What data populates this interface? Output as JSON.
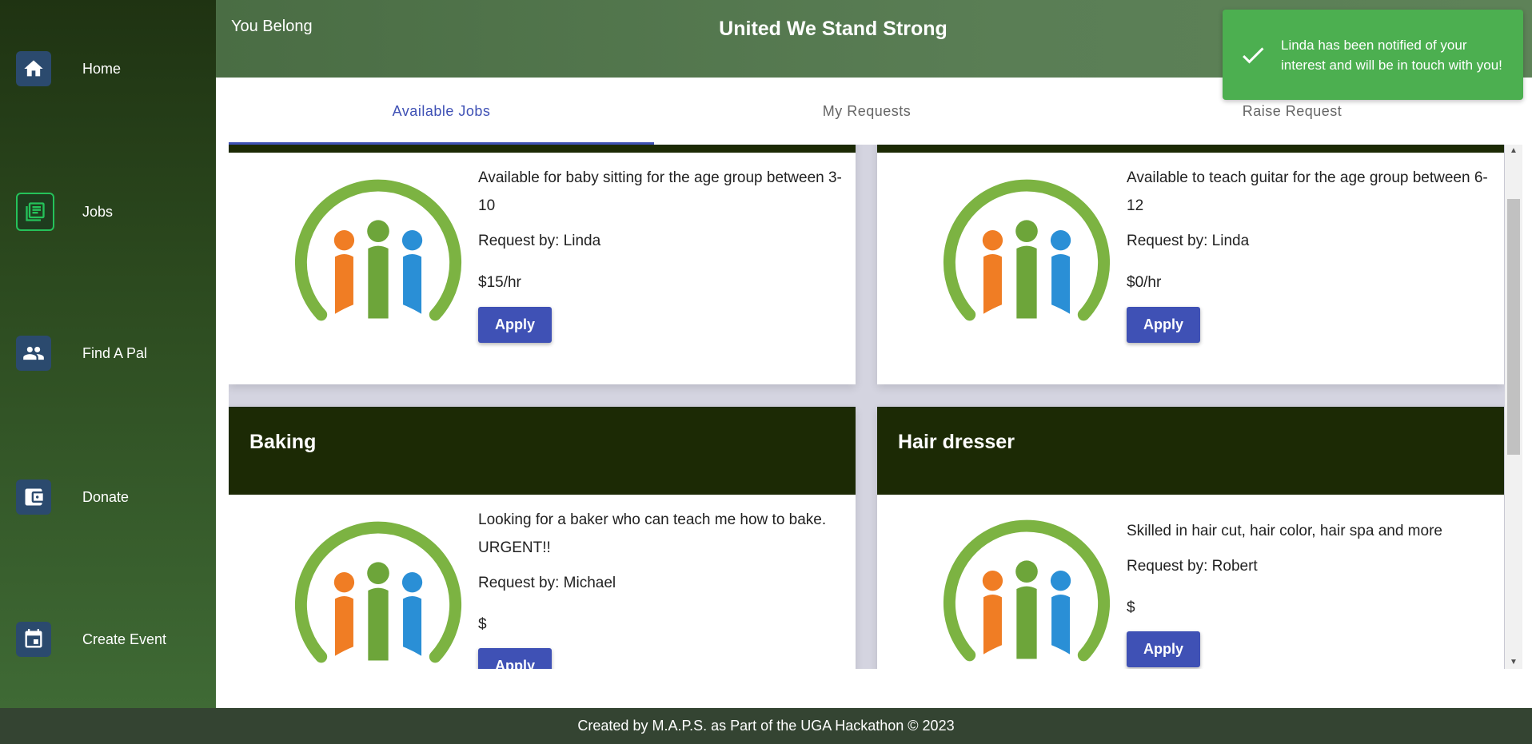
{
  "sidebar": {
    "items": [
      {
        "label": "Home",
        "icon": "home-icon"
      },
      {
        "label": "Jobs",
        "icon": "newspaper-icon",
        "active": true
      },
      {
        "label": "Find A Pal",
        "icon": "people-icon"
      },
      {
        "label": "Donate",
        "icon": "wallet-icon"
      },
      {
        "label": "Create Event",
        "icon": "calendar-icon"
      }
    ]
  },
  "header": {
    "brand": "You Belong",
    "title": "United We Stand Strong"
  },
  "toast": {
    "message": "Linda has been notified of your interest and will be in touch with you!",
    "icon": "check-icon",
    "color": "#4caf50"
  },
  "tabs": [
    {
      "label": "Available Jobs",
      "active": true
    },
    {
      "label": "My Requests"
    },
    {
      "label": "Raise Request"
    }
  ],
  "cards": [
    {
      "description": "Available for baby sitting for the age group between 3-10",
      "requester": "Request by: Linda",
      "rate": "$15/hr",
      "button": "Apply"
    },
    {
      "description": "Available to teach guitar for the age group between 6-12",
      "requester": "Request by: Linda",
      "rate": "$0/hr",
      "button": "Apply"
    },
    {
      "title": "Baking",
      "description": "Looking for a baker who can teach me how to bake. URGENT!!",
      "requester": "Request by: Michael",
      "rate": "$",
      "button": "Apply"
    },
    {
      "title": "Hair dresser",
      "description": "Skilled in hair cut, hair color, hair spa and more",
      "requester": "Request by: Robert",
      "rate": "$",
      "button": "Apply"
    }
  ],
  "footer": {
    "text": "Created by M.A.P.S. as Part of the UGA Hackathon © 2023"
  },
  "colors": {
    "accent": "#3f51b5",
    "card_header": "#1c2a05",
    "toast": "#4caf50"
  }
}
